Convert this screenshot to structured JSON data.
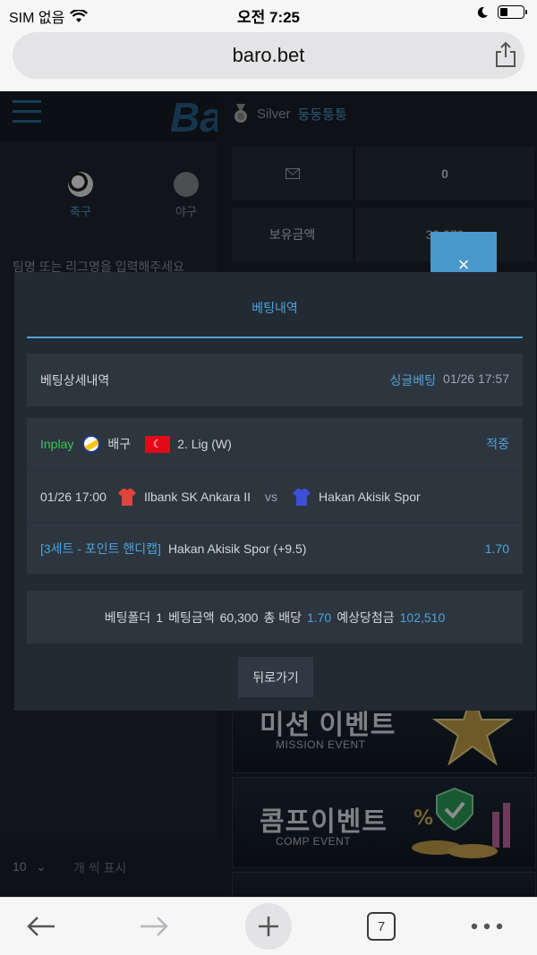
{
  "status_bar": {
    "carrier": "SIM 없음",
    "time": "오전 7:25"
  },
  "browser": {
    "url": "baro.bet",
    "tabs_count": "7"
  },
  "site": {
    "logo": "Ba",
    "sport_tabs": [
      {
        "label": "축구"
      },
      {
        "label": "야구"
      }
    ],
    "search_hint": "팀명 또는 리그명을 입력해주세요",
    "page_size": {
      "count": "10",
      "label": "개 씩 표시"
    }
  },
  "user_panel": {
    "grade": "Silver",
    "username": "둥둥퉁퉁",
    "message_count": "0",
    "balance_label": "보유금액",
    "balance_value": "30,070"
  },
  "banners": [
    {
      "title": "미션 이벤트",
      "subtitle": "MISSION EVENT"
    },
    {
      "title": "콤프이벤트",
      "subtitle": "COMP EVENT"
    }
  ],
  "modal": {
    "close_label": "×",
    "title": "베팅내역",
    "detail_label": "베팅상세내역",
    "bet_type": "싱글베팅",
    "bet_time": "01/26 17:57",
    "match": {
      "inplay_label": "Inplay",
      "sport": "배구",
      "league": "2. Lig (W)",
      "result": "적중",
      "match_time": "01/26 17:00",
      "home_team": "Ilbank SK Ankara II",
      "vs": "vs",
      "away_team": "Hakan Akisik Spor",
      "market": "[3세트 - 포인트 핸디캡]",
      "pick": "Hakan Akisik Spor (+9.5)",
      "odds": "1.70"
    },
    "summary": {
      "folder_label": "베팅폴더",
      "folder_value": "1",
      "amount_label": "베팅금액",
      "amount_value": "60,300",
      "total_odds_label": "총 배당",
      "total_odds_value": "1.70",
      "expected_label": "예상당첨금",
      "expected_value": "102,510"
    },
    "back_button": "뒤로가기"
  },
  "colors": {
    "accent": "#4da3d8",
    "inplay_green": "#35c759",
    "modal_bg": "#222a33",
    "row_bg": "#2d353f"
  }
}
